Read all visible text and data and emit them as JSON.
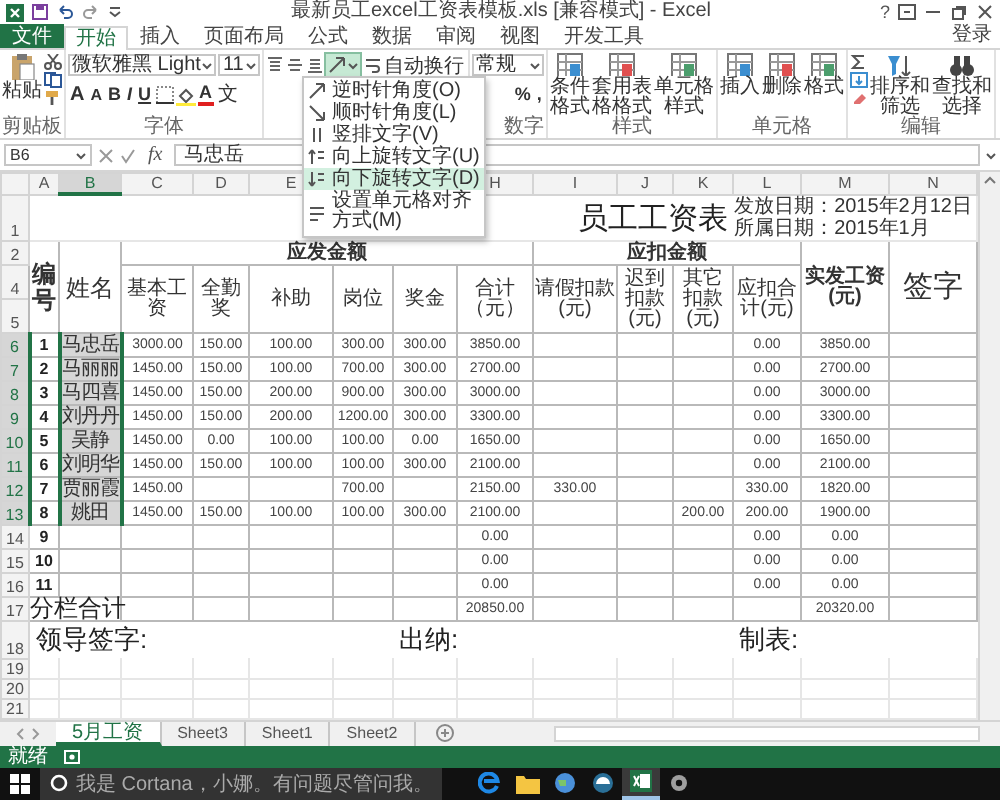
{
  "window": {
    "title": "最新员工excel工资表模板.xls [兼容模式] - Excel",
    "help": "?"
  },
  "ribbon": {
    "tabs": [
      {
        "label": "文件",
        "kind": "file",
        "selected": false
      },
      {
        "label": "开始",
        "kind": "tab",
        "selected": true
      },
      {
        "label": "插入",
        "kind": "tab",
        "selected": false
      },
      {
        "label": "页面布局",
        "kind": "tab",
        "selected": false
      },
      {
        "label": "公式",
        "kind": "tab",
        "selected": false
      },
      {
        "label": "数据",
        "kind": "tab",
        "selected": false
      },
      {
        "label": "审阅",
        "kind": "tab",
        "selected": false
      },
      {
        "label": "视图",
        "kind": "tab",
        "selected": false
      },
      {
        "label": "开发工具",
        "kind": "tab",
        "selected": false
      }
    ],
    "sign_in": "登录",
    "groups": [
      {
        "kind": "clipboard",
        "label": "剪贴板",
        "paste": "粘贴"
      },
      {
        "kind": "font",
        "label": "字体",
        "font_name": "微软雅黑 Light",
        "font_size": "11",
        "size_buttons": [
          "A",
          "A"
        ],
        "style_buttons": [
          "B",
          "I",
          "U"
        ],
        "font_color": "A",
        "phonetic": "文"
      },
      {
        "kind": "alignment",
        "wrap": "自动换行",
        "orientation_expanded": true
      },
      {
        "kind": "number",
        "label": "数字",
        "format": "常规",
        "symbols": [
          "%",
          ","
        ]
      },
      {
        "kind": "buttons",
        "label": "样式",
        "buttons": [
          "条件格式",
          "套用表格格式",
          "单元格样式"
        ]
      },
      {
        "kind": "buttons",
        "label": "单元格",
        "buttons": [
          "插入",
          "删除",
          "格式"
        ]
      },
      {
        "kind": "editing",
        "label": "编辑",
        "buttons": [
          "排序和筛选",
          "查找和选择"
        ]
      }
    ]
  },
  "orientation_menu": {
    "items": [
      {
        "label": "逆时针角度(O)",
        "selected": false
      },
      {
        "label": "顺时针角度(L)",
        "selected": false
      },
      {
        "label": "竖排文字(V)",
        "selected": false
      },
      {
        "label": "向上旋转文字(U)",
        "selected": false
      },
      {
        "label": "向下旋转文字(D)",
        "selected": true
      },
      {
        "label": "设置单元格对齐方式(M)",
        "selected": false
      }
    ]
  },
  "formula_bar": {
    "name_box": "B6",
    "function_label": "fx",
    "value": "马忠岳"
  },
  "sheet": {
    "columns": [
      {
        "label": "A",
        "selected": false
      },
      {
        "label": "B",
        "selected": true
      },
      {
        "label": "C",
        "selected": false
      },
      {
        "label": "D",
        "selected": false
      },
      {
        "label": "E",
        "selected": false
      },
      null,
      null,
      {
        "label": "H",
        "selected": false
      },
      {
        "label": "I",
        "selected": false
      },
      {
        "label": "J",
        "selected": false
      },
      {
        "label": "K",
        "selected": false
      },
      {
        "label": "L",
        "selected": false
      },
      {
        "label": "M",
        "selected": false
      },
      {
        "label": "N",
        "selected": false
      }
    ],
    "title_row": {
      "row": "1",
      "title": "员工工资表",
      "dates": [
        "发放日期：2015年2月12日",
        "所属日期：2015年1月"
      ]
    },
    "header": {
      "rows": [
        "2",
        "4",
        "5"
      ],
      "number": "编号",
      "name": "姓名",
      "net": "实发工资(元)",
      "sign": "签字",
      "groups": [
        {
          "label": "应发金额",
          "columns": [
            "基本工资",
            "全勤奖",
            "补助",
            "岗位",
            "奖金",
            "合计（元）"
          ]
        },
        {
          "label": "应扣金额",
          "columns": [
            "请假扣款(元)",
            "迟到扣款(元)",
            "其它扣款(元)",
            "应扣合计(元)"
          ]
        }
      ]
    },
    "rows": [
      {
        "row": "6",
        "selected": true,
        "cells": [
          "1",
          "马忠岳",
          "3000.00",
          "150.00",
          "100.00",
          "300.00",
          "300.00",
          "3850.00",
          null,
          null,
          null,
          "0.00",
          "3850.00",
          null
        ]
      },
      {
        "row": "7",
        "selected": true,
        "cells": [
          "2",
          "马丽丽",
          "1450.00",
          "150.00",
          "100.00",
          "700.00",
          "300.00",
          "2700.00",
          null,
          null,
          null,
          "0.00",
          "2700.00",
          null
        ]
      },
      {
        "row": "8",
        "selected": true,
        "cells": [
          "3",
          "马四喜",
          "1450.00",
          "150.00",
          "200.00",
          "900.00",
          "300.00",
          "3000.00",
          null,
          null,
          null,
          "0.00",
          "3000.00",
          null
        ]
      },
      {
        "row": "9",
        "selected": true,
        "cells": [
          "4",
          "刘丹丹",
          "1450.00",
          "150.00",
          "200.00",
          "1200.00",
          "300.00",
          "3300.00",
          null,
          null,
          null,
          "0.00",
          "3300.00",
          null
        ]
      },
      {
        "row": "10",
        "selected": true,
        "cells": [
          "5",
          "吴静",
          "1450.00",
          "0.00",
          "100.00",
          "100.00",
          "0.00",
          "1650.00",
          null,
          null,
          null,
          "0.00",
          "1650.00",
          null
        ]
      },
      {
        "row": "11",
        "selected": true,
        "cells": [
          "6",
          "刘明华",
          "1450.00",
          "150.00",
          "100.00",
          "100.00",
          "300.00",
          "2100.00",
          null,
          null,
          null,
          "0.00",
          "2100.00",
          null
        ]
      },
      {
        "row": "12",
        "selected": true,
        "cells": [
          "7",
          "贾丽霞",
          "1450.00",
          null,
          null,
          "700.00",
          null,
          "2150.00",
          "330.00",
          null,
          null,
          "330.00",
          "1820.00",
          null
        ]
      },
      {
        "row": "13",
        "selected": true,
        "cells": [
          "8",
          "姚田",
          "1450.00",
          "150.00",
          "100.00",
          "100.00",
          "300.00",
          "2100.00",
          null,
          null,
          "200.00",
          "200.00",
          "1900.00",
          null
        ]
      },
      {
        "row": "14",
        "selected": false,
        "cells": [
          "9",
          null,
          null,
          null,
          null,
          null,
          null,
          "0.00",
          null,
          null,
          null,
          "0.00",
          "0.00",
          null
        ]
      },
      {
        "row": "15",
        "selected": false,
        "cells": [
          "10",
          null,
          null,
          null,
          null,
          null,
          null,
          "0.00",
          null,
          null,
          null,
          "0.00",
          "0.00",
          null
        ]
      },
      {
        "row": "16",
        "selected": false,
        "cells": [
          "11",
          null,
          null,
          null,
          null,
          null,
          null,
          "0.00",
          null,
          null,
          null,
          "0.00",
          "0.00",
          null
        ]
      }
    ],
    "total_row": {
      "row": "17",
      "label": "分栏合计",
      "cells": [
        null,
        null,
        null,
        null,
        null,
        "20850.00",
        null,
        null,
        null,
        null,
        "20320.00",
        null
      ]
    },
    "signature_row": {
      "row": "18",
      "labels": [
        "领导签字:",
        "出纳:",
        "制表:"
      ]
    },
    "empty_rows": [
      "19",
      "20",
      "21"
    ]
  },
  "sheet_tabs": [
    {
      "label": "5月工资",
      "selected": true
    },
    {
      "label": "Sheet3",
      "selected": false
    },
    {
      "label": "Sheet1",
      "selected": false
    },
    {
      "label": "Sheet2",
      "selected": false
    }
  ],
  "status_bar": {
    "text": "就绪"
  },
  "taskbar": {
    "search": {
      "placeholder": "我是 Cortana，小娜。有问题尽管问我。"
    }
  }
}
